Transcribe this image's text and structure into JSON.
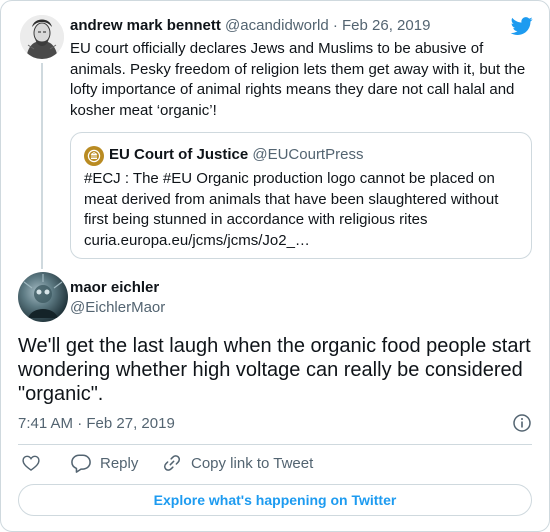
{
  "parent_tweet": {
    "name": "andrew mark bennett",
    "handle": "@acandidworld",
    "separator": "·",
    "date": "Feb 26, 2019",
    "text": "EU court officially declares Jews and Muslims to be abusive of animals. Pesky freedom of religion lets them get away with it, but the lofty importance of animal rights means they dare not call halal and kosher meat ‘organic’!"
  },
  "quoted_tweet": {
    "name": "EU Court of Justice",
    "handle": "@EUCourtPress",
    "text_line1": "#ECJ : The #EU Organic production logo cannot be placed on",
    "text_line2": "meat derived from animals that have been slaughtered without",
    "text_line3": "first being stunned in accordance with religious rites",
    "link": "curia.europa.eu/jcms/jcms/Jo2_…"
  },
  "reply_tweet": {
    "name": "maor eichler",
    "handle": "@EichlerMaor",
    "text": "We'll get the last laugh when the organic food people start wondering whether high voltage can really be considered \"organic\".",
    "time": "7:41 AM",
    "separator": "·",
    "date": "Feb 27, 2019"
  },
  "actions": {
    "reply_label": "Reply",
    "copy_link_label": "Copy link to Tweet"
  },
  "explore_button_label": "Explore what's happening on Twitter",
  "icons": [
    "twitter-bird-icon",
    "info-icon",
    "heart-icon",
    "reply-bubble-icon",
    "link-icon"
  ],
  "colors": {
    "accent": "#1d9bf0",
    "muted": "#536471",
    "border": "#cfd9de",
    "text": "#0f1419"
  }
}
